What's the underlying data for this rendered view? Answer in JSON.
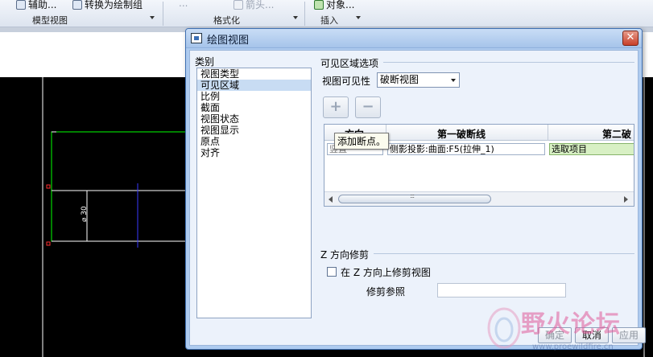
{
  "ribbon": {
    "items": [
      {
        "label": "辅助...",
        "dim": false
      },
      {
        "label": "转换为绘制组",
        "dim": false
      },
      {
        "label": "...",
        "dim": true
      },
      {
        "label": "箭头...",
        "dim": true
      },
      {
        "label": "对象...",
        "dim": false
      }
    ],
    "groups": [
      "模型视图",
      "格式化",
      "插入"
    ]
  },
  "drawing": {
    "dimension_text": "⌀ 30",
    "colors": {
      "outline": "#00ff00",
      "white": "#ffffff",
      "blue": "#3a3aff",
      "red": "#ff3030"
    }
  },
  "dialog": {
    "title": "绘图视图",
    "close_icon": "✕",
    "category_label": "类别",
    "categories": [
      "视图类型",
      "可见区域",
      "比例",
      "截面",
      "视图状态",
      "视图显示",
      "原点",
      "对齐"
    ],
    "selected_category": 1,
    "visible_area": {
      "section_title": "可见区域选项",
      "visibility_label": "视图可见性",
      "visibility_value": "破断视图",
      "add_icon": "+",
      "remove_icon": "−",
      "table": {
        "headers": [
          "方向",
          "第一破断线",
          "第二破"
        ],
        "row": {
          "direction": "竖直",
          "first": "侧影投影:曲面:F5(拉伸_1)",
          "second": "选取项目"
        },
        "tooltip": "添加断点。"
      }
    },
    "z_trim": {
      "section_title": "Z 方向修剪",
      "checkbox_label": "在 Z 方向上修剪视图",
      "checked": false,
      "ref_label": "修剪参照",
      "ref_value": ""
    },
    "buttons": {
      "ok": "确定",
      "cancel": "取消",
      "apply": "应用"
    }
  },
  "watermark": {
    "text": "野火论坛",
    "url": "www.proewildfire.cn"
  }
}
